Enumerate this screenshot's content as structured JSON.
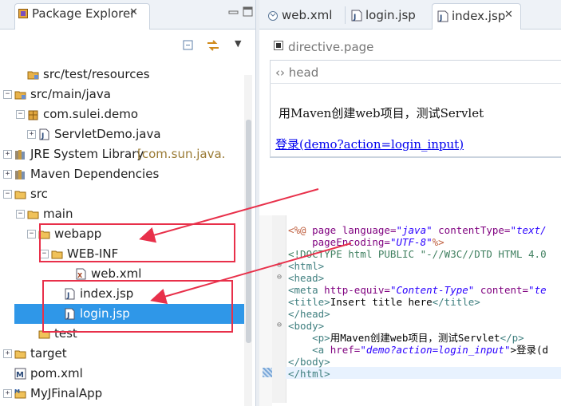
{
  "package_explorer": {
    "tab_title": "Package Explorer",
    "tab_close": "✕",
    "toolbar": {
      "menu_glyph": "▼"
    },
    "tree": [
      {
        "label": "src/test/resources",
        "icon": "source-folder-icon",
        "twist": ""
      },
      {
        "label": "src/main/java",
        "icon": "source-folder-icon",
        "twist": "−"
      },
      {
        "label": "com.sulei.demo",
        "icon": "package-icon",
        "twist": "−"
      },
      {
        "label": "ServletDemo.java",
        "icon": "java-file-icon",
        "twist": "+"
      },
      {
        "label": "JRE System Library",
        "sub": "[com.sun.java.",
        "icon": "library-icon",
        "twist": "+"
      },
      {
        "label": "Maven Dependencies",
        "icon": "library-icon",
        "twist": "+"
      },
      {
        "label": "src",
        "icon": "folder-icon",
        "twist": "−"
      },
      {
        "label": "main",
        "icon": "folder-icon",
        "twist": "−"
      },
      {
        "label": "webapp",
        "icon": "folder-icon",
        "twist": "−"
      },
      {
        "label": "WEB-INF",
        "icon": "folder-icon",
        "twist": "−"
      },
      {
        "label": "web.xml",
        "icon": "xml-file-icon",
        "twist": ""
      },
      {
        "label": "index.jsp",
        "icon": "jsp-file-icon",
        "twist": ""
      },
      {
        "label": "login.jsp",
        "icon": "jsp-file-icon",
        "twist": "",
        "selected": true
      },
      {
        "label": "test",
        "icon": "folder-icon",
        "twist": ""
      },
      {
        "label": "target",
        "icon": "folder-icon",
        "twist": "+"
      },
      {
        "label": "pom.xml",
        "icon": "maven-pom-icon",
        "twist": ""
      },
      {
        "label": "MyJFinalApp",
        "icon": "project-icon",
        "twist": "+"
      }
    ]
  },
  "editor": {
    "tabs": [
      {
        "label": "web.xml",
        "icon": "xml-file-icon"
      },
      {
        "label": "login.jsp",
        "icon": "jsp-file-icon"
      },
      {
        "label": "index.jsp",
        "icon": "jsp-file-icon",
        "active": true
      }
    ],
    "tab_close": "✕",
    "preview": {
      "directive_label": "directive.page",
      "head_label": "‹› head",
      "paragraph": "用Maven创建web项目，测试Servlet",
      "link_text": "登录(demo?action=login_input)"
    },
    "source": {
      "line1": {
        "jsp_open": "<%@",
        "kw": " page ",
        "a1": "language=",
        "v1": "\"java\"",
        "a2": " contentType=",
        "v2": "\"text/"
      },
      "line2": {
        "indent": "    ",
        "a": "pageEncoding=",
        "v": "\"UTF-8\"",
        "close": "%>"
      },
      "line3": {
        "text": "<!DOCTYPE html PUBLIC \"-//W3C//DTD HTML 4.0"
      },
      "line4": {
        "text": "<html>"
      },
      "line5": {
        "text": "<head>"
      },
      "line6": {
        "tag": "<meta",
        "a1": " http-equiv=",
        "v1": "\"Content-Type\"",
        "a2": " content=",
        "v2": "\"te"
      },
      "line7": {
        "open": "<title>",
        "text": "Insert title here",
        "close": "</title>"
      },
      "line8": {
        "text": "</head>"
      },
      "line9": {
        "text": "<body>"
      },
      "line10": {
        "indent": "    ",
        "open": "<p>",
        "text": "用Maven创建web项目，测试Servlet",
        "close": "</p>"
      },
      "line11": {
        "indent": "    ",
        "tag": "<a",
        "a": " href=",
        "v": "\"demo?action=login_input\"",
        "rest": ">登录(d"
      },
      "line12": {
        "text": "</body>"
      },
      "line13": {
        "text": "</html>"
      }
    }
  },
  "colors": {
    "selection": "#2f97e8",
    "annotation": "#e8304a",
    "link": "#0000ee"
  }
}
